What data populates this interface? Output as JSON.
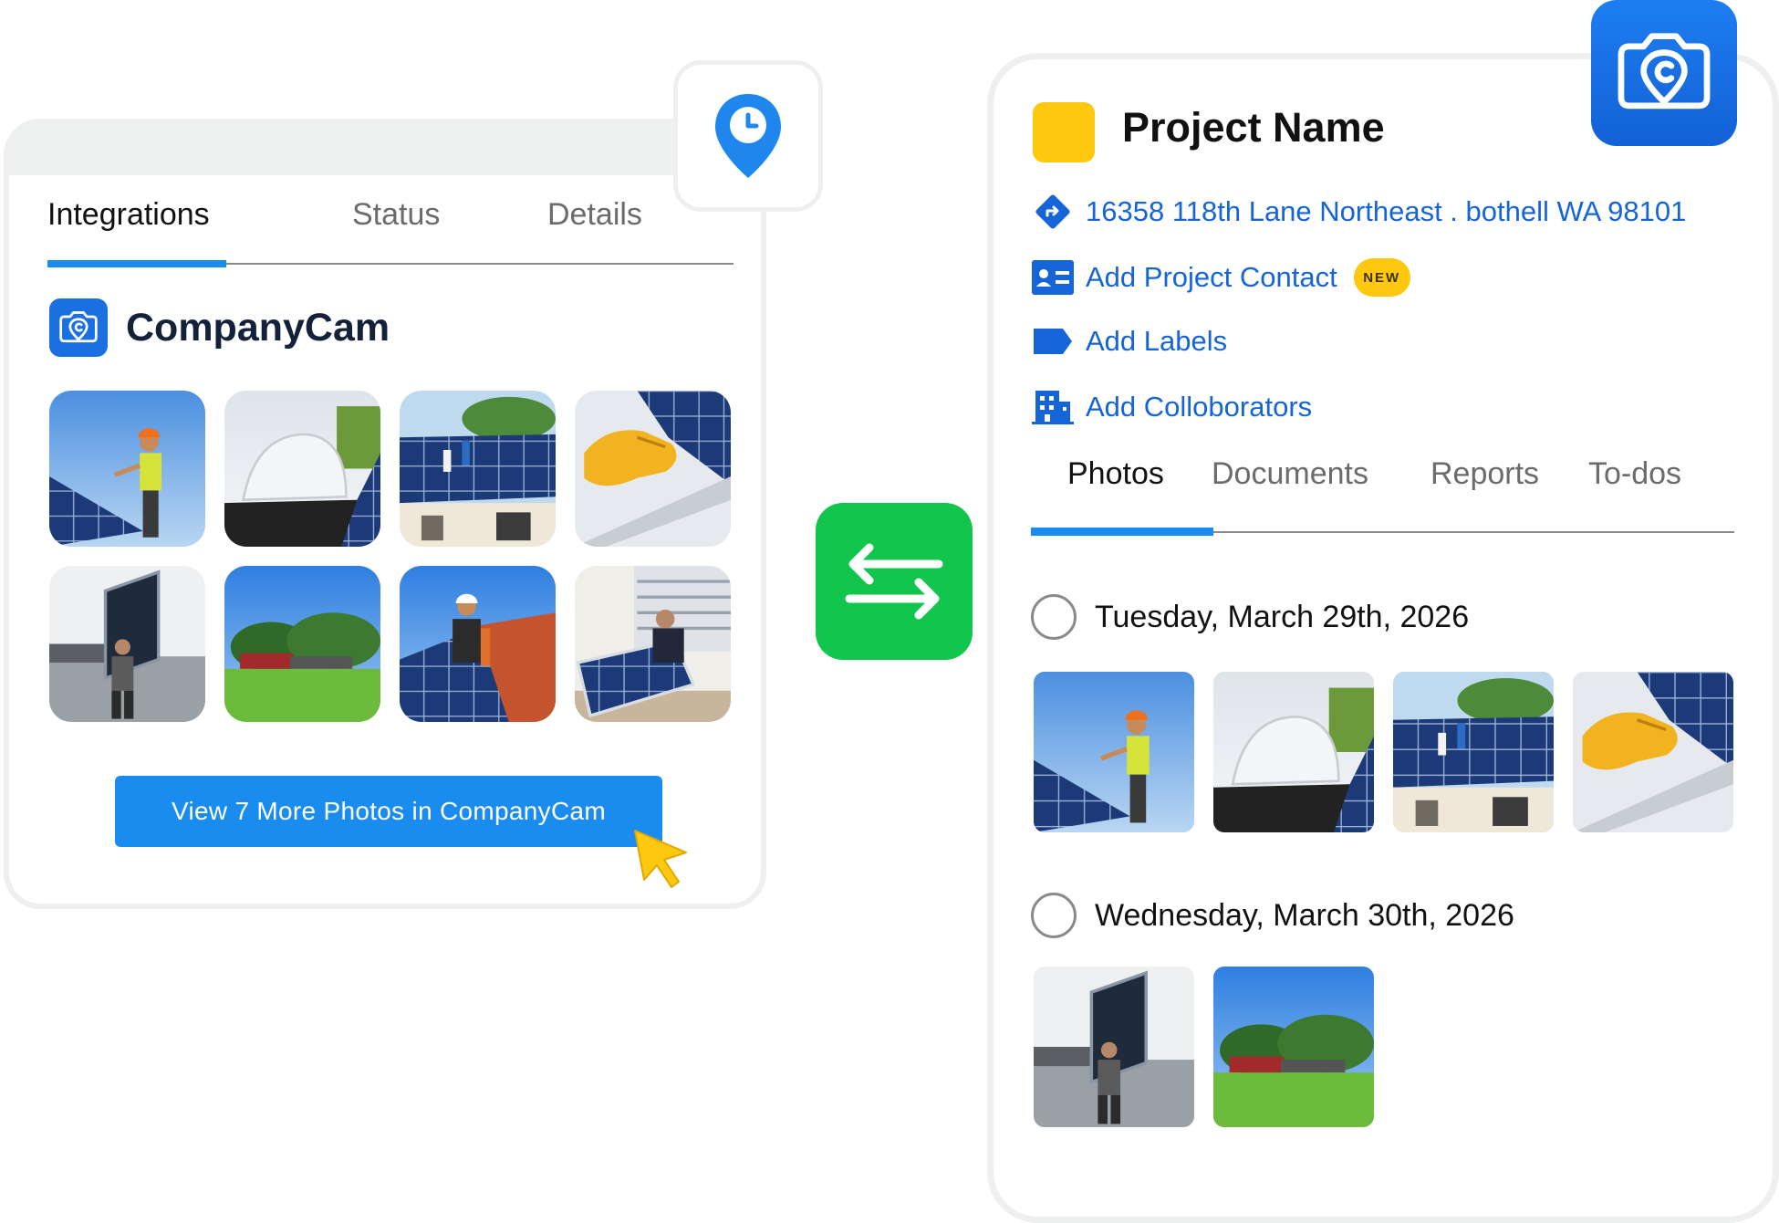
{
  "left_panel": {
    "tabs": [
      {
        "label": "Integrations",
        "active": true
      },
      {
        "label": "Status",
        "active": false
      },
      {
        "label": "Details",
        "active": false
      }
    ],
    "integration_name": "CompanyCam",
    "view_more_button": "View 7 More Photos in CompanyCam"
  },
  "right_panel": {
    "project_name": "Project Name",
    "address": "16358 118th Lane Northeast . bothell WA 98101",
    "add_contact": "Add Project Contact",
    "new_badge": "NEW",
    "add_labels": "Add Labels",
    "add_collaborators": "Add Colloborators",
    "tabs": [
      {
        "label": "Photos",
        "active": true
      },
      {
        "label": "Documents",
        "active": false
      },
      {
        "label": "Reports",
        "active": false
      },
      {
        "label": "To-dos",
        "active": false
      }
    ],
    "days": [
      {
        "label": "Tuesday, March 29th, 2026"
      },
      {
        "label": "Wednesday, March 30th, 2026"
      }
    ]
  },
  "colors": {
    "accent_blue": "#1a8cf0",
    "link_blue": "#1565d8",
    "brand_yellow": "#fdc80e",
    "swap_green": "#11c54d"
  },
  "icons": {
    "pin": "location-clock-icon",
    "swap": "swap-arrows-icon",
    "camera": "companycam-camera-icon",
    "cursor": "mouse-cursor-icon"
  }
}
